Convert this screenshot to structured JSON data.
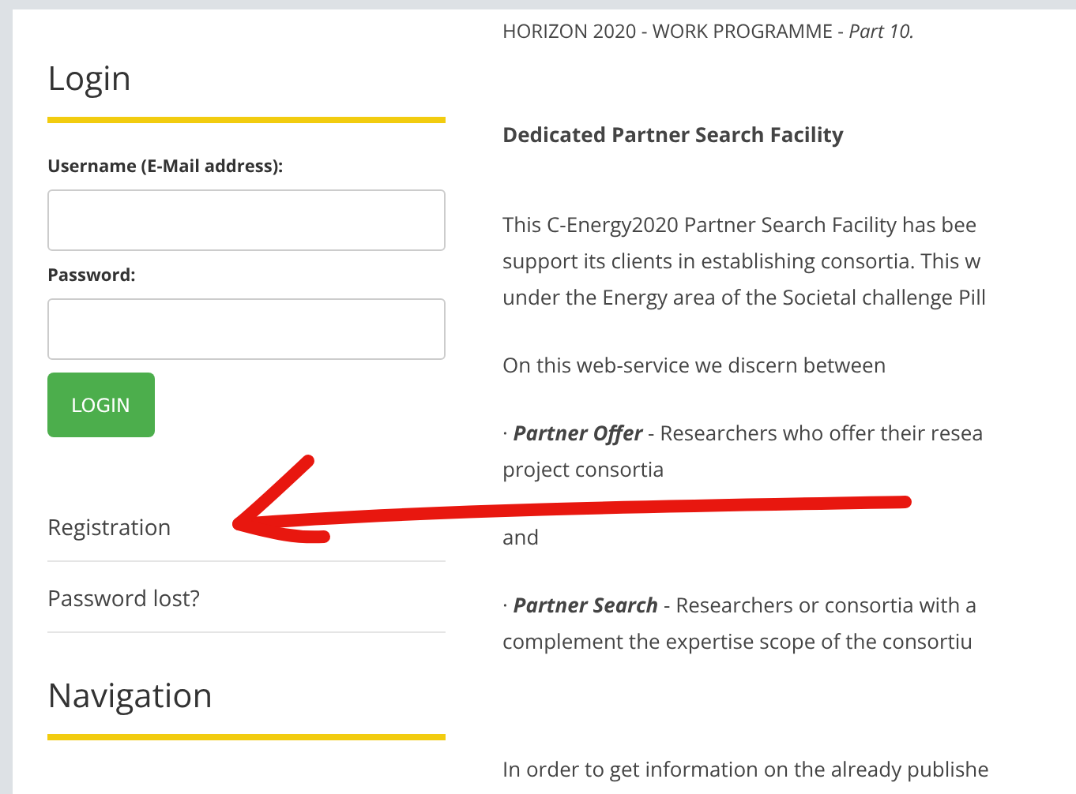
{
  "login": {
    "title": "Login",
    "fields": [
      {
        "label": "Username (E-Mail address):"
      },
      {
        "label": "Password:"
      }
    ],
    "button": "LOGIN",
    "links": [
      "Registration",
      "Password lost?"
    ]
  },
  "navigation": {
    "title": "Navigation"
  },
  "content": {
    "blocks": [
      {
        "kind": "title",
        "lines": [
          "HORIZON 2020 - WORK PROGRAMME - *Part 10.*"
        ]
      },
      {
        "kind": "subtitle",
        "lines": [
          "Dedicated Partner Search Facility"
        ]
      },
      {
        "kind": "paragraph",
        "lines": [
          "This C-Energy2020 Partner Search Facility has bee",
          "support its clients in establishing consortia. This w",
          "under the Energy area of the Societal challenge Pill"
        ]
      },
      {
        "kind": "paragraph",
        "lines": [
          "On this web-service we discern between"
        ]
      },
      {
        "kind": "paragraph",
        "lines": [
          "· **Partner Offer** - Researchers who offer their resea",
          "project consortia"
        ]
      },
      {
        "kind": "paragraph",
        "lines": [
          "and"
        ]
      },
      {
        "kind": "paragraph",
        "lines": [
          "· **Partner Search** - Researchers or consortia with a",
          "complement the expertise scope of the consortiu"
        ]
      },
      {
        "kind": "paragraph",
        "lines": [
          "In order to get information on the already publishe"
        ]
      }
    ]
  }
}
